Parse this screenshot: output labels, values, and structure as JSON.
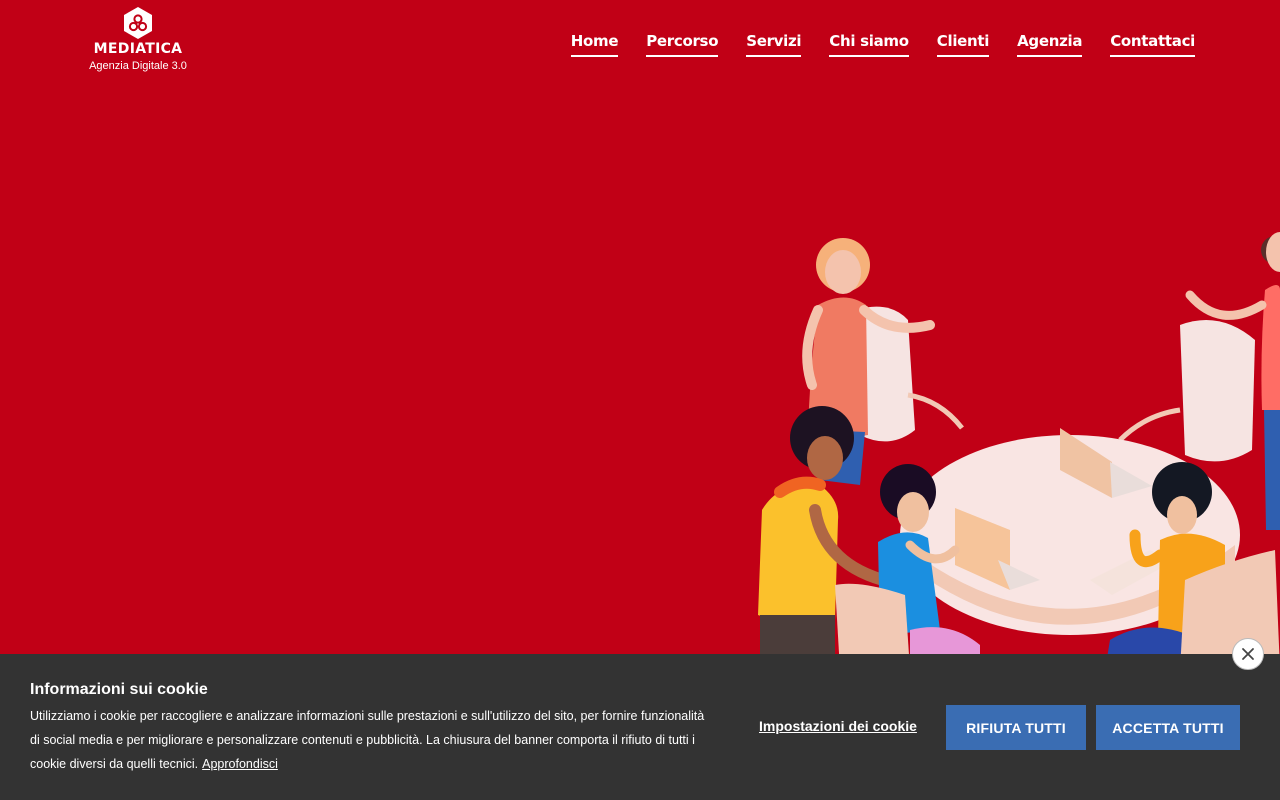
{
  "brand": {
    "name": "MEDIATICA",
    "tagline": "Agenzia Digitale 3.0"
  },
  "nav": {
    "items": [
      "Home",
      "Percorso",
      "Servizi",
      "Chi siamo",
      "Clienti",
      "Agenzia",
      "Contattaci"
    ]
  },
  "hero": {
    "illustration": "team-meeting-illustration"
  },
  "cookie": {
    "title": "Informazioni sui cookie",
    "text": "Utilizziamo i cookie per raccogliere e analizzare informazioni sulle prestazioni e sull'utilizzo del sito, per fornire funzionalità di social media e per migliorare e personalizzare contenuti e pubblicità. La chiusura del banner comporta il rifiuto di tutti i cookie diversi da quelli tecnici.",
    "learn_more": "Approfondisci",
    "settings_label": "Impostazioni dei cookie",
    "reject_label": "RIFIUTA TUTTI",
    "accept_label": "ACCETTA TUTTI",
    "close_icon": "close-icon"
  },
  "colors": {
    "background": "#c10016",
    "banner": "#333333",
    "button": "#3a6db3"
  }
}
